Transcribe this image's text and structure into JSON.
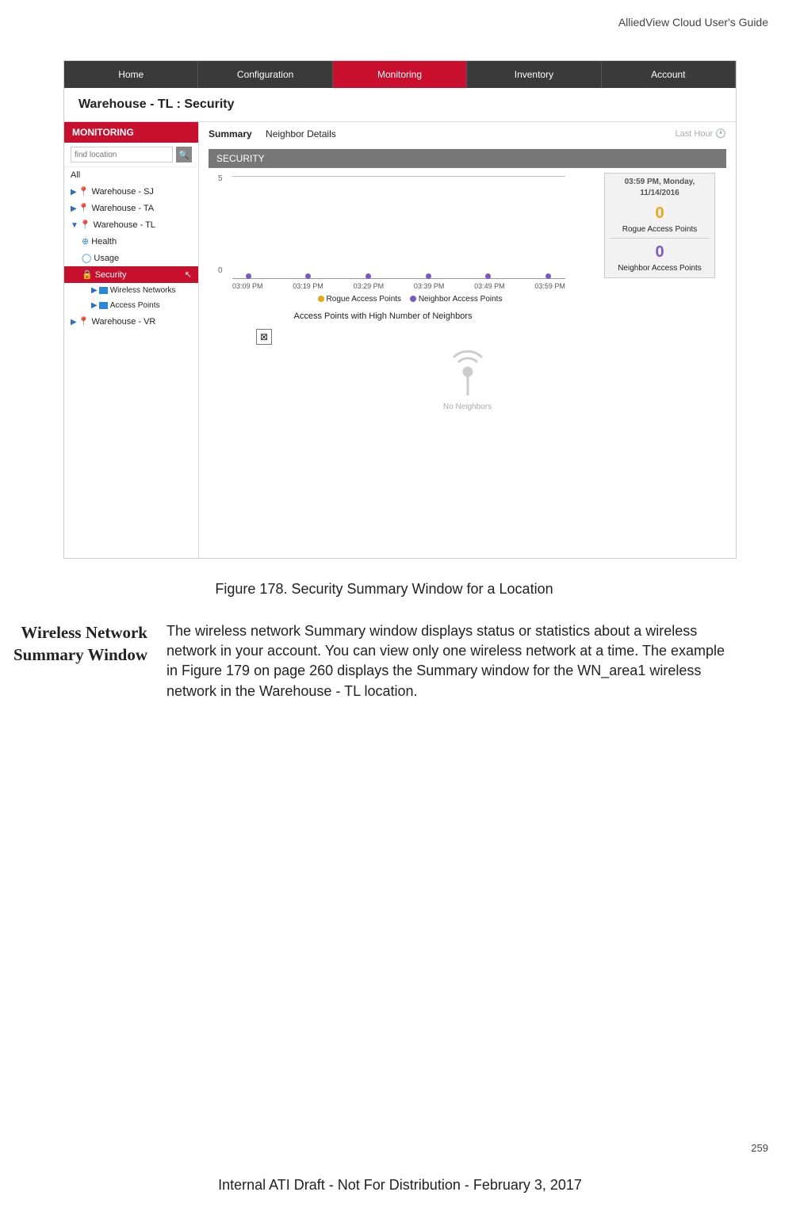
{
  "doc": {
    "header": "AlliedView Cloud User's Guide",
    "page_number": "259",
    "footer": "Internal ATI Draft - Not For Distribution - February 3, 2017"
  },
  "app": {
    "tabs": [
      "Home",
      "Configuration",
      "Monitoring",
      "Inventory",
      "Account"
    ],
    "breadcrumb": "Warehouse - TL : Security",
    "sidebar": {
      "title": "MONITORING",
      "search_placeholder": "find location",
      "all": "All",
      "items": [
        {
          "label": "Warehouse - SJ",
          "expanded": false
        },
        {
          "label": "Warehouse - TA",
          "expanded": false
        },
        {
          "label": "Warehouse - TL",
          "expanded": true,
          "children": [
            {
              "label": "Health",
              "icon": "plus"
            },
            {
              "label": "Usage",
              "icon": "circle"
            },
            {
              "label": "Security",
              "icon": "lock",
              "selected": true,
              "children": [
                {
                  "label": "Wireless Networks"
                },
                {
                  "label": "Access Points"
                }
              ]
            }
          ]
        },
        {
          "label": "Warehouse - VR",
          "expanded": false
        }
      ]
    },
    "subtabs": {
      "active": "Summary",
      "other": "Neighbor Details",
      "time": "Last Hour"
    },
    "chart_title": "SECURITY",
    "tooltip": {
      "timestamp": "03:59 PM, Monday, 11/14/2016",
      "rogue_value": "0",
      "rogue_label": "Rogue Access Points",
      "neighbor_value": "0",
      "neighbor_label": "Neighbor Access Points"
    },
    "legend": {
      "a": "Rogue Access Points",
      "b": "Neighbor Access Points"
    },
    "subheading": "Access Points with High Number of Neighbors",
    "no_neighbors": "No Neighbors"
  },
  "figure_caption": "Figure 178. Security Summary Window for a Location",
  "section": {
    "title": "Wireless Network Summary Window",
    "body": "The wireless network Summary window displays status or statistics about a wireless network in your account. You can view only one wireless network at a time. The example in Figure 179 on page 260 displays the Summary window for the WN_area1 wireless network in the Warehouse - TL location."
  },
  "chart_data": {
    "type": "line",
    "title": "SECURITY",
    "ylabel": "",
    "ylim": [
      0,
      5
    ],
    "categories": [
      "03:09 PM",
      "03:19 PM",
      "03:29 PM",
      "03:39 PM",
      "03:49 PM",
      "03:59 PM"
    ],
    "series": [
      {
        "name": "Rogue Access Points",
        "color": "#e6a817",
        "values": [
          0,
          0,
          0,
          0,
          0,
          0
        ]
      },
      {
        "name": "Neighbor Access Points",
        "color": "#7b57c9",
        "values": [
          0,
          0,
          0,
          0,
          0,
          0
        ]
      }
    ]
  }
}
